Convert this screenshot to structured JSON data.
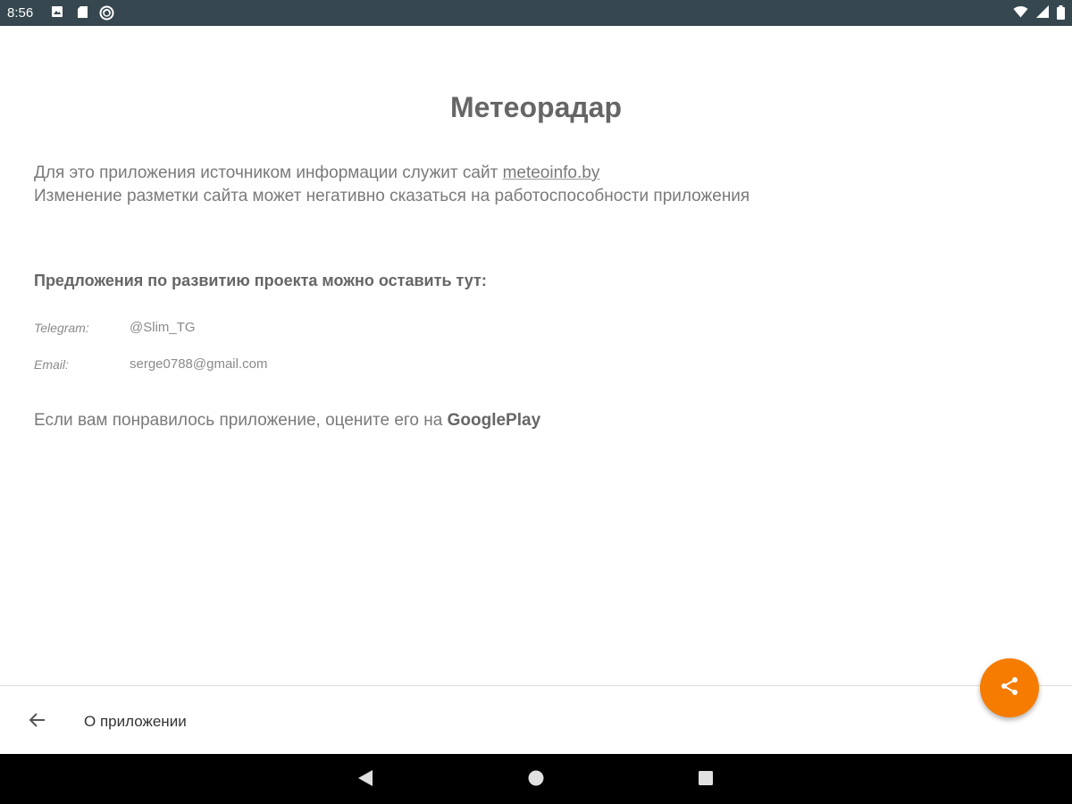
{
  "status_bar": {
    "time": "8:56",
    "icons_left": [
      "photo-icon",
      "sd-card-icon",
      "sync-icon"
    ],
    "icons_right": [
      "wifi-icon",
      "cell-signal-icon",
      "battery-icon"
    ]
  },
  "content": {
    "title": "Метеорадар",
    "info_line_1_prefix": "Для это приложения источником информации служит сайт ",
    "site_link": "meteoinfo.by",
    "info_line_2": "Изменение разметки сайта может негативно сказаться на работоспособности приложения",
    "suggestions_heading": "Предложения по развитию проекта можно оставить тут:",
    "contacts": {
      "telegram_label": "Telegram:",
      "telegram_value": "@Slim_TG",
      "email_label": "Email:",
      "email_value": "serge0788@gmail.com"
    },
    "rate_prefix": "Если вам понравилось приложение, оцените его на ",
    "rate_link": "GooglePlay"
  },
  "bottom_bar": {
    "title": "О приложении",
    "back_icon": "arrow-back-icon"
  },
  "fab": {
    "icon": "share-icon",
    "color": "#f57c00"
  },
  "nav_bar": {
    "buttons": [
      "nav-back-icon",
      "nav-home-icon",
      "nav-recents-icon"
    ]
  },
  "colors": {
    "status_bar": "#36474f",
    "accent": "#f57c00",
    "text_primary": "#666666",
    "text_secondary": "#7a7a7a"
  }
}
